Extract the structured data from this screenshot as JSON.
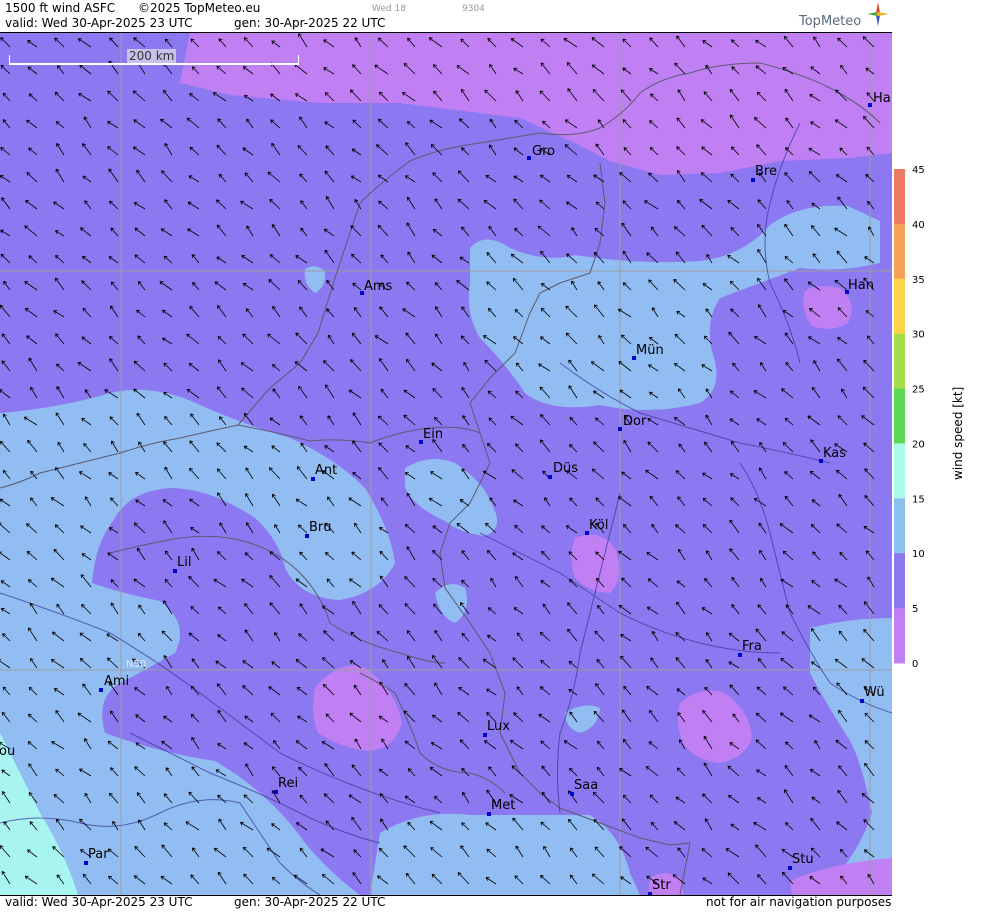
{
  "header": {
    "title": "1500 ft wind ASFC",
    "copyright": "©2025 TopMeteo.eu",
    "valid_line": "valid:  Wed  30-Apr-2025  23 UTC",
    "gen_line": "gen: 30-Apr-2025 22 UTC",
    "faint_day": "Wed 18",
    "faint_code": "9304",
    "brand": "TopMeteo"
  },
  "map": {
    "scale_label": "200 km",
    "lat_label": "N50",
    "cities": [
      {
        "id": "gro",
        "label": "Gro"
      },
      {
        "id": "bre",
        "label": "Bre"
      },
      {
        "id": "ha",
        "label": "Ha"
      },
      {
        "id": "ams",
        "label": "Ams"
      },
      {
        "id": "han",
        "label": "Han"
      },
      {
        "id": "mun",
        "label": "Mün"
      },
      {
        "id": "ein",
        "label": "Ein"
      },
      {
        "id": "dor",
        "label": "Dor"
      },
      {
        "id": "kas",
        "label": "Kas"
      },
      {
        "id": "ant",
        "label": "Ant"
      },
      {
        "id": "dus",
        "label": "Düs"
      },
      {
        "id": "bru",
        "label": "Bru"
      },
      {
        "id": "kol",
        "label": "Köl"
      },
      {
        "id": "lil",
        "label": "Lil"
      },
      {
        "id": "fra",
        "label": "Fra"
      },
      {
        "id": "ami",
        "label": "Ami"
      },
      {
        "id": "wu",
        "label": "Wü"
      },
      {
        "id": "lux",
        "label": "Lux"
      },
      {
        "id": "ou",
        "label": "ou"
      },
      {
        "id": "rei",
        "label": "Rei"
      },
      {
        "id": "saa",
        "label": "Saa"
      },
      {
        "id": "met",
        "label": "Met"
      },
      {
        "id": "par",
        "label": "Par"
      },
      {
        "id": "stu",
        "label": "Stu"
      },
      {
        "id": "str",
        "label": "Str"
      }
    ]
  },
  "footer": {
    "valid_line": "valid:  Wed  30-Apr-2025  23 UTC",
    "gen_line": "gen: 30-Apr-2025 22 UTC",
    "disclaimer": "not for air navigation purposes"
  },
  "legend": {
    "axis_label": "wind speed  [kt]",
    "ticks": [
      "45",
      "40",
      "35",
      "30",
      "25",
      "20",
      "15",
      "10",
      "5",
      "0"
    ],
    "colors": [
      "#ef7a62",
      "#f7a058",
      "#fcd44a",
      "#a6de4a",
      "#5ad858",
      "#a8fce8",
      "#8cc0f0",
      "#8c78f0",
      "#c080f4"
    ]
  },
  "colors": {
    "calm": "#c080f4",
    "light": "#8c78f0",
    "moderate": "#92bdf2",
    "fresh": "#a8f4f0"
  }
}
